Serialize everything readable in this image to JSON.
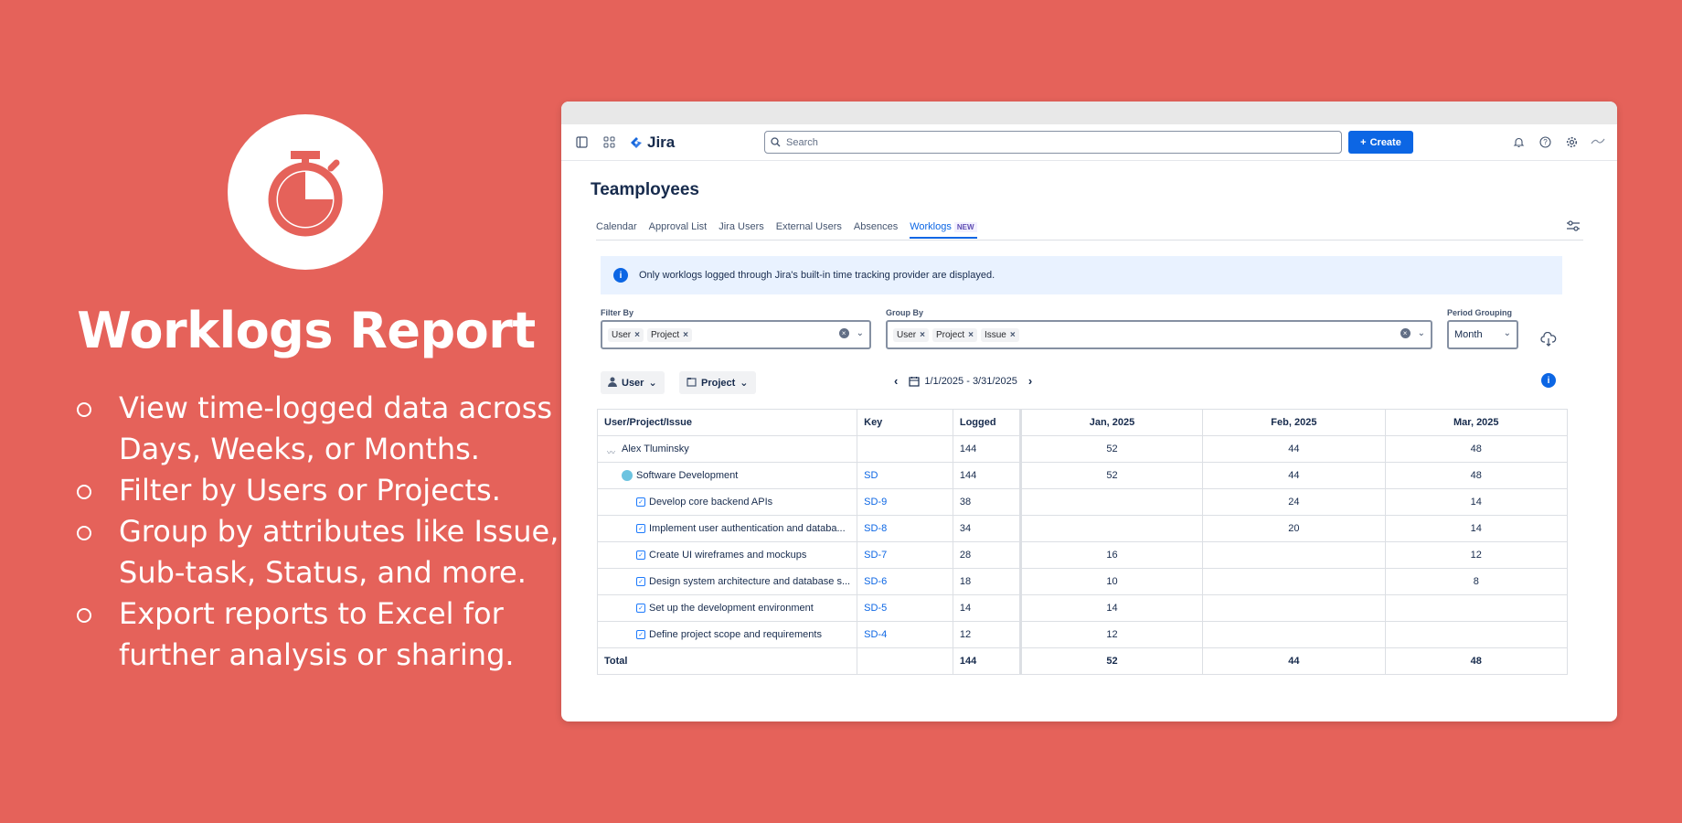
{
  "promo": {
    "title": "Worklogs Report",
    "icon": "stopwatch-icon",
    "bullets": [
      "View time-logged data across Days, Weeks, or Months.",
      "Filter by Users or Projects.",
      "Group by attributes like Issue, Sub-task, Status, and more.",
      "Export reports to Excel for further analysis or sharing."
    ]
  },
  "topbar": {
    "app_name": "Jira",
    "search_placeholder": "Search",
    "create_label": "Create"
  },
  "page": {
    "title": "Teamployees",
    "tabs": [
      {
        "label": "Calendar"
      },
      {
        "label": "Approval List"
      },
      {
        "label": "Jira Users"
      },
      {
        "label": "External Users"
      },
      {
        "label": "Absences"
      },
      {
        "label": "Worklogs",
        "badge": "NEW",
        "active": true
      }
    ],
    "info_text": "Only worklogs logged through Jira's built-in time tracking provider are displayed."
  },
  "filters": {
    "filter_by_label": "Filter By",
    "filter_by_chips": [
      "User",
      "Project"
    ],
    "group_by_label": "Group By",
    "group_by_chips": [
      "User",
      "Project",
      "Issue"
    ],
    "period_label": "Period Grouping",
    "period_value": "Month",
    "user_button": "User",
    "project_button": "Project",
    "date_range": "1/1/2025 - 3/31/2025"
  },
  "table": {
    "headers": [
      "User/Project/Issue",
      "Key",
      "Logged",
      "Jan, 2025",
      "Feb, 2025",
      "Mar, 2025"
    ],
    "rows": [
      {
        "name": "Alex Tluminsky",
        "key": "",
        "logged": "144",
        "jan": "52",
        "feb": "44",
        "mar": "48"
      },
      {
        "name": "Software Development",
        "key": "SD",
        "logged": "144",
        "jan": "52",
        "feb": "44",
        "mar": "48"
      },
      {
        "name": "Develop core backend APIs",
        "key": "SD-9",
        "logged": "38",
        "jan": "",
        "feb": "24",
        "mar": "14"
      },
      {
        "name": "Implement user authentication and databa...",
        "key": "SD-8",
        "logged": "34",
        "jan": "",
        "feb": "20",
        "mar": "14"
      },
      {
        "name": "Create UI wireframes and mockups",
        "key": "SD-7",
        "logged": "28",
        "jan": "16",
        "feb": "",
        "mar": "12"
      },
      {
        "name": "Design system architecture and database s...",
        "key": "SD-6",
        "logged": "18",
        "jan": "10",
        "feb": "",
        "mar": "8"
      },
      {
        "name": "Set up the development environment",
        "key": "SD-5",
        "logged": "14",
        "jan": "14",
        "feb": "",
        "mar": ""
      },
      {
        "name": "Define project scope and requirements",
        "key": "SD-4",
        "logged": "12",
        "jan": "12",
        "feb": "",
        "mar": ""
      }
    ],
    "total": {
      "name": "Total",
      "key": "",
      "logged": "144",
      "jan": "52",
      "feb": "44",
      "mar": "48"
    }
  }
}
